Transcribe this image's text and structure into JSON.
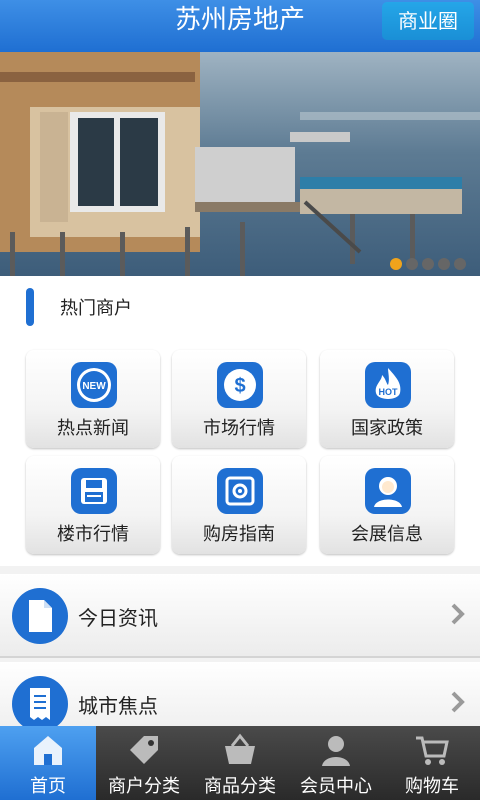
{
  "header": {
    "title": "苏州房地产",
    "biz_button": "商业圈"
  },
  "carousel": {
    "total": 5,
    "active_index": 0
  },
  "section": {
    "title": "热门商户"
  },
  "grid": [
    {
      "label": "热点新闻",
      "icon": "new-badge-icon"
    },
    {
      "label": "市场行情",
      "icon": "dollar-icon"
    },
    {
      "label": "国家政策",
      "icon": "hot-flame-icon"
    },
    {
      "label": "楼市行情",
      "icon": "floppy-icon"
    },
    {
      "label": "购房指南",
      "icon": "safe-icon"
    },
    {
      "label": "会展信息",
      "icon": "person-icon"
    }
  ],
  "list": [
    {
      "label": "今日资讯",
      "icon": "document-icon"
    },
    {
      "label": "城市焦点",
      "icon": "receipt-icon"
    }
  ],
  "nav": [
    {
      "label": "首页",
      "icon": "home-icon",
      "active": true
    },
    {
      "label": "商户分类",
      "icon": "tag-icon"
    },
    {
      "label": "商品分类",
      "icon": "basket-icon"
    },
    {
      "label": "会员中心",
      "icon": "user-icon"
    },
    {
      "label": "购物车",
      "icon": "cart-icon"
    }
  ],
  "colors": {
    "primary": "#1f6fd2",
    "accent": "#f0a31b",
    "nav_bg": "#333333"
  }
}
